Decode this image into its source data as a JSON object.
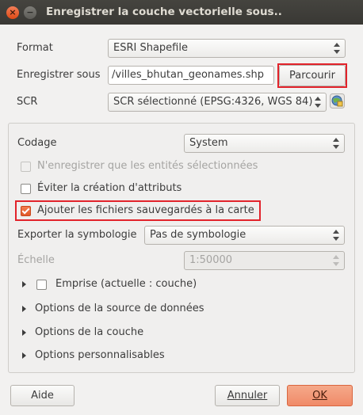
{
  "window": {
    "title": "Enregistrer la couche vectorielle sous.."
  },
  "form": {
    "format_label": "Format",
    "format_value": "ESRI Shapefile",
    "save_as_label": "Enregistrer sous",
    "save_as_value": "/villes_bhutan_geonames.shp",
    "browse_label": "Parcourir",
    "crs_label": "SCR",
    "crs_value": "SCR sélectionné (EPSG:4326, WGS 84)"
  },
  "options": {
    "encoding_label": "Codage",
    "encoding_value": "System",
    "selected_only_label": "N'enregistrer que les entités sélectionnées",
    "skip_attributes_label": "Éviter la création d'attributs",
    "add_to_map_label": "Ajouter les fichiers sauvegardés à la carte",
    "symbology_label": "Exporter la symbologie",
    "symbology_value": "Pas de symbologie",
    "scale_label": "Échelle",
    "scale_value": "1:50000",
    "extent_label": "Emprise (actuelle : couche)",
    "datasource_label": "Options de la source de données",
    "layer_label": "Options de la couche",
    "custom_label": "Options personnalisables"
  },
  "states": {
    "selected_only": false,
    "skip_attributes": false,
    "add_to_map": true,
    "extent": false
  },
  "buttons": {
    "help": "Aide",
    "cancel": "Annuler",
    "ok": "OK"
  },
  "colors": {
    "accent": "#e05a2a",
    "highlight": "#e2232b"
  }
}
